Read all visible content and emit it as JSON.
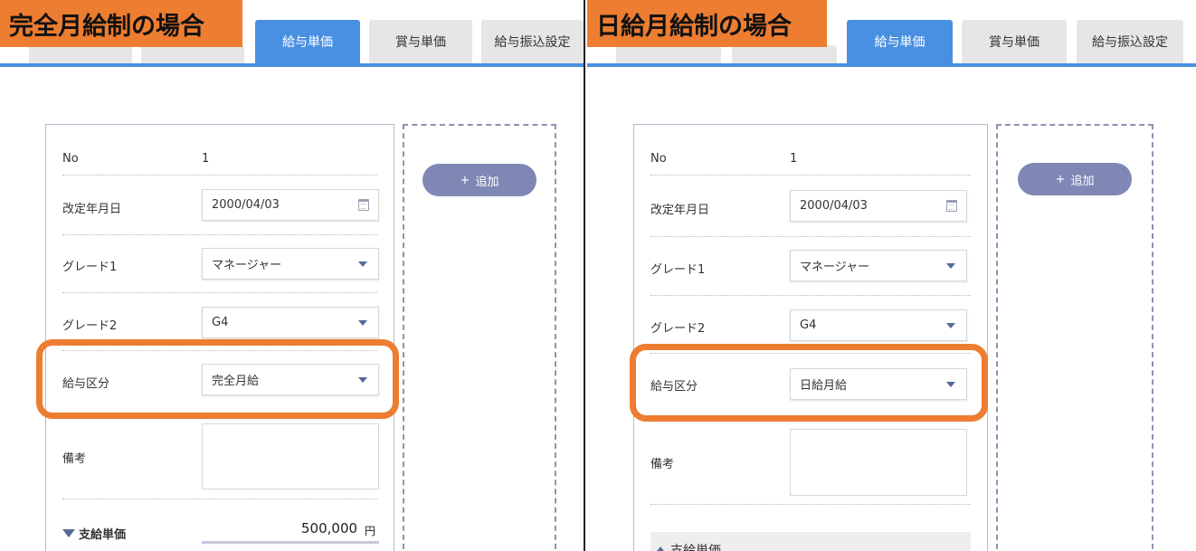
{
  "left": {
    "title": "完全月給制の場合",
    "tabs": [
      "給与単価",
      "賞与単価",
      "給与振込設定"
    ],
    "active_tab": "給与単価",
    "add_button": {
      "icon": "+",
      "label": "追加"
    },
    "form": {
      "no_label": "No",
      "no_value": "1",
      "date_label": "改定年月日",
      "date_value": "2000/04/03",
      "grade1_label": "グレード1",
      "grade1_value": "マネージャー",
      "grade2_label": "グレード2",
      "grade2_value": "G4",
      "pay_type_label": "給与区分",
      "pay_type_value": "完全月給",
      "note_label": "備考",
      "note_value": "",
      "section_label": "支給単価",
      "amount": "500,000",
      "unit": "円"
    }
  },
  "right": {
    "title": "日給月給制の場合",
    "tabs": [
      "給与単価",
      "賞与単価",
      "給与振込設定"
    ],
    "active_tab": "給与単価",
    "add_button": {
      "icon": "+",
      "label": "追加"
    },
    "form": {
      "no_label": "No",
      "no_value": "1",
      "date_label": "改定年月日",
      "date_value": "2000/04/03",
      "grade1_label": "グレード1",
      "grade1_value": "マネージャー",
      "grade2_label": "グレード2",
      "grade2_value": "G4",
      "pay_type_label": "給与区分",
      "pay_type_value": "日給月給",
      "note_label": "備考",
      "note_value": "",
      "section_label": "支給単価"
    }
  },
  "colors": {
    "accent_blue": "#4a90e2",
    "highlight_orange": "#ed7d31",
    "add_button": "#7f88b5",
    "caret": "#556a98"
  }
}
